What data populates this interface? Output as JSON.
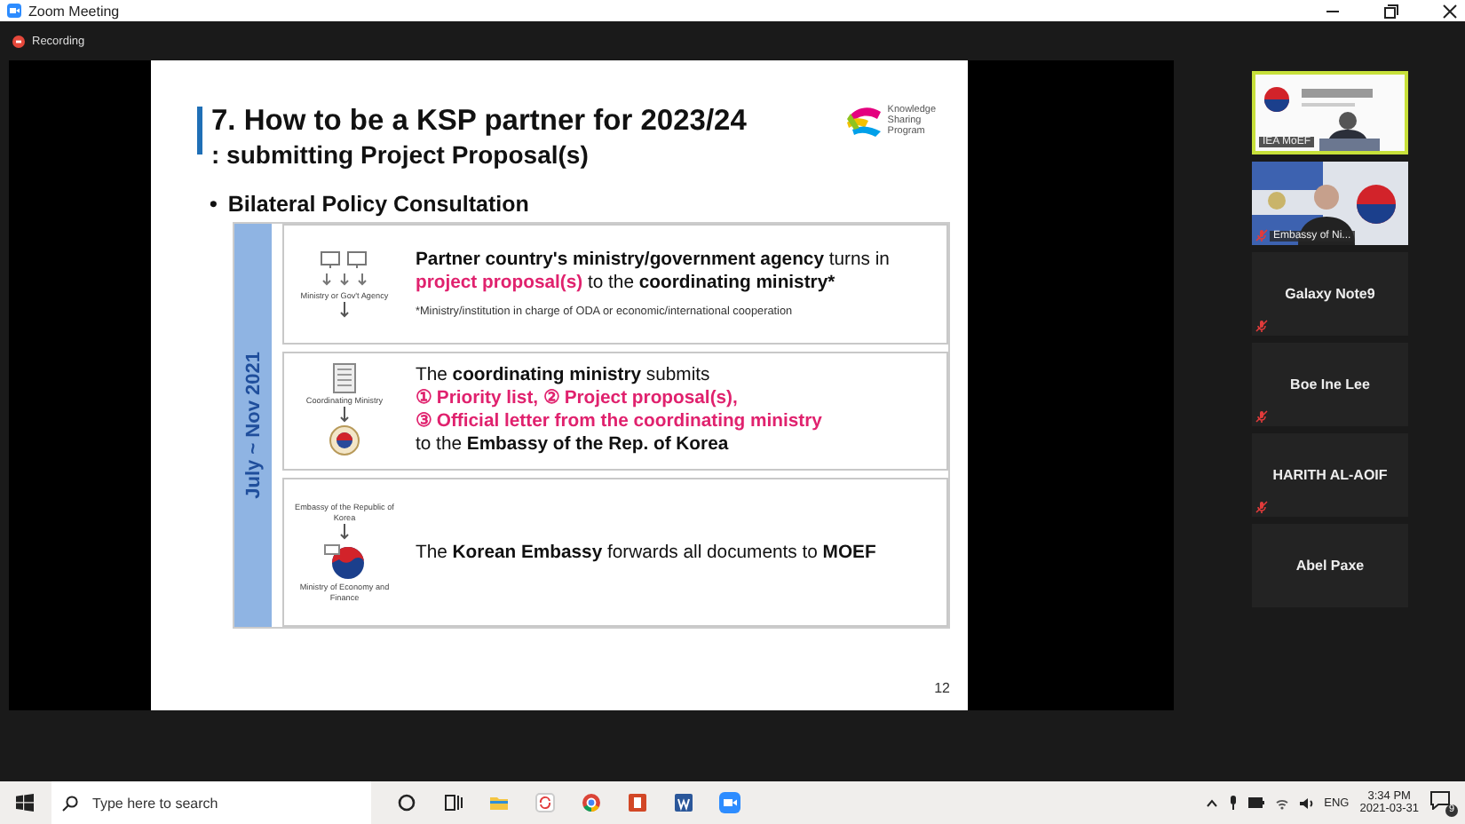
{
  "window": {
    "title": "Zoom Meeting"
  },
  "recording": {
    "label": "Recording"
  },
  "slide": {
    "title": "7. How to be a KSP partner for 2023/24",
    "subtitle": ": submitting Project Proposal(s)",
    "logo_lines": [
      "Knowledge",
      "Sharing",
      "Program"
    ],
    "bullet_mark": "•",
    "bullet": "Bilateral Policy Consultation",
    "period": "July ~ Nov 2021",
    "steps": [
      {
        "icon_labels": [
          "Ministry or Gov't Agency"
        ],
        "lines": [
          [
            {
              "text": "Partner country's ministry/government agency",
              "kind": "bold"
            },
            {
              "text": " turns in",
              "kind": "plain"
            }
          ],
          [
            {
              "text": "project proposal(s)",
              "kind": "accent"
            },
            {
              "text": " to the ",
              "kind": "plain"
            },
            {
              "text": "coordinating ministry*",
              "kind": "bold"
            }
          ]
        ],
        "note": "*Ministry/institution in charge of ODA or economic/international cooperation"
      },
      {
        "icon_labels": [
          "Coordinating Ministry"
        ],
        "lines": [
          [
            {
              "text": "The ",
              "kind": "plain"
            },
            {
              "text": "coordinating ministry",
              "kind": "bold"
            },
            {
              "text": " submits",
              "kind": "plain"
            }
          ],
          [
            {
              "text": "① Priority list, ② Project proposal(s),",
              "kind": "accent"
            }
          ],
          [
            {
              "text": "③ Official letter from the coordinating ministry",
              "kind": "accent"
            }
          ],
          [
            {
              "text": "to the ",
              "kind": "plain"
            },
            {
              "text": "Embassy of the Rep. of Korea",
              "kind": "bold"
            }
          ]
        ]
      },
      {
        "icon_labels": [
          "Embassy of the Republic of Korea",
          "Ministry of Economy and Finance"
        ],
        "lines": [
          [
            {
              "text": "The ",
              "kind": "plain"
            },
            {
              "text": "Korean Embassy",
              "kind": "bold"
            },
            {
              "text": " forwards all documents to ",
              "kind": "plain"
            },
            {
              "text": "MOEF",
              "kind": "bold"
            }
          ]
        ]
      }
    ],
    "page_number": "12"
  },
  "participants": [
    {
      "name": "IEA MoEF",
      "kind": "video",
      "speaking": true,
      "muted": false
    },
    {
      "name": "Embassy of Ni...",
      "kind": "video",
      "speaking": false,
      "muted": true
    },
    {
      "name": "Galaxy Note9",
      "kind": "name",
      "speaking": false,
      "muted": true
    },
    {
      "name": "Boe Ine Lee",
      "kind": "name",
      "speaking": false,
      "muted": true
    },
    {
      "name": "HARITH AL-AOIF",
      "kind": "name",
      "speaking": false,
      "muted": true
    },
    {
      "name": "Abel Paxe",
      "kind": "name",
      "speaking": false,
      "muted": false
    }
  ],
  "taskbar": {
    "search_placeholder": "Type here to search",
    "language": "ENG",
    "time": "3:34 PM",
    "date": "2021-03-31",
    "notification_count": "9"
  }
}
